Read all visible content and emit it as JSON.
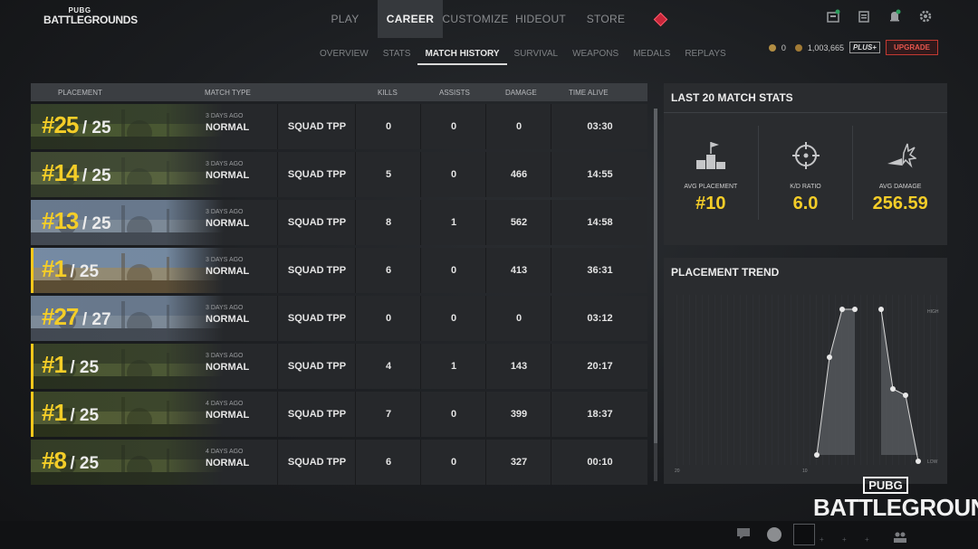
{
  "brand": {
    "top_line": "PUBG",
    "bottom_line": "BATTLEGROUNDS"
  },
  "nav": {
    "tabs": [
      "PLAY",
      "CAREER",
      "CUSTOMIZE",
      "HIDEOUT",
      "STORE"
    ],
    "active": "CAREER"
  },
  "top_icons": [
    "inventory-icon",
    "clipboard-icon",
    "bell-icon",
    "gear-icon"
  ],
  "subnav": {
    "tabs": [
      "OVERVIEW",
      "STATS",
      "MATCH HISTORY",
      "SURVIVAL",
      "WEAPONS",
      "MEDALS",
      "REPLAYS"
    ],
    "active": "MATCH HISTORY"
  },
  "currency": {
    "gcoin": "0",
    "bp": "1,003,665",
    "plus": "PLUS+",
    "upgrade": "UPGRADE"
  },
  "table": {
    "headers": {
      "placement": "PLACEMENT",
      "match_type": "MATCH TYPE",
      "kills": "KILLS",
      "assists": "ASSISTS",
      "damage": "DAMAGE",
      "time_alive": "TIME ALIVE"
    },
    "rows": [
      {
        "rank": "#25",
        "total": "/ 25",
        "ago": "3 DAYS AGO",
        "mode": "NORMAL",
        "type": "SQUAD TPP",
        "kills": "0",
        "assists": "0",
        "damage": "0",
        "time": "03:30",
        "win": false
      },
      {
        "rank": "#14",
        "total": "/ 25",
        "ago": "3 DAYS AGO",
        "mode": "NORMAL",
        "type": "SQUAD TPP",
        "kills": "5",
        "assists": "0",
        "damage": "466",
        "time": "14:55",
        "win": false
      },
      {
        "rank": "#13",
        "total": "/ 25",
        "ago": "3 DAYS AGO",
        "mode": "NORMAL",
        "type": "SQUAD TPP",
        "kills": "8",
        "assists": "1",
        "damage": "562",
        "time": "14:58",
        "win": false
      },
      {
        "rank": "#1",
        "total": "/ 25",
        "ago": "3 DAYS AGO",
        "mode": "NORMAL",
        "type": "SQUAD TPP",
        "kills": "6",
        "assists": "0",
        "damage": "413",
        "time": "36:31",
        "win": true
      },
      {
        "rank": "#27",
        "total": "/ 27",
        "ago": "3 DAYS AGO",
        "mode": "NORMAL",
        "type": "SQUAD TPP",
        "kills": "0",
        "assists": "0",
        "damage": "0",
        "time": "03:12",
        "win": false
      },
      {
        "rank": "#1",
        "total": "/ 25",
        "ago": "3 DAYS AGO",
        "mode": "NORMAL",
        "type": "SQUAD TPP",
        "kills": "4",
        "assists": "1",
        "damage": "143",
        "time": "20:17",
        "win": true
      },
      {
        "rank": "#1",
        "total": "/ 25",
        "ago": "4 DAYS AGO",
        "mode": "NORMAL",
        "type": "SQUAD TPP",
        "kills": "7",
        "assists": "0",
        "damage": "399",
        "time": "18:37",
        "win": true
      },
      {
        "rank": "#8",
        "total": "/ 25",
        "ago": "4 DAYS AGO",
        "mode": "NORMAL",
        "type": "SQUAD TPP",
        "kills": "6",
        "assists": "0",
        "damage": "327",
        "time": "00:10",
        "win": false
      }
    ]
  },
  "last20": {
    "title": "LAST 20 MATCH STATS",
    "stats": [
      {
        "label": "AVG PLACEMENT",
        "value": "#10",
        "icon": "podium-icon"
      },
      {
        "label": "K/D RATIO",
        "value": "6.0",
        "icon": "crosshair-icon"
      },
      {
        "label": "AVG DAMAGE",
        "value": "256.59",
        "icon": "bullet-impact-icon"
      }
    ]
  },
  "trend": {
    "title": "PLACEMENT TREND",
    "tick_right_top": "HIGH",
    "tick_left_bottom": "20",
    "tick_mid_bottom": "10",
    "tick_right_bottom": "LOW"
  },
  "colors": {
    "accent": "#f4cd28",
    "upgrade": "#e6564d",
    "event": "#c9263a"
  }
}
